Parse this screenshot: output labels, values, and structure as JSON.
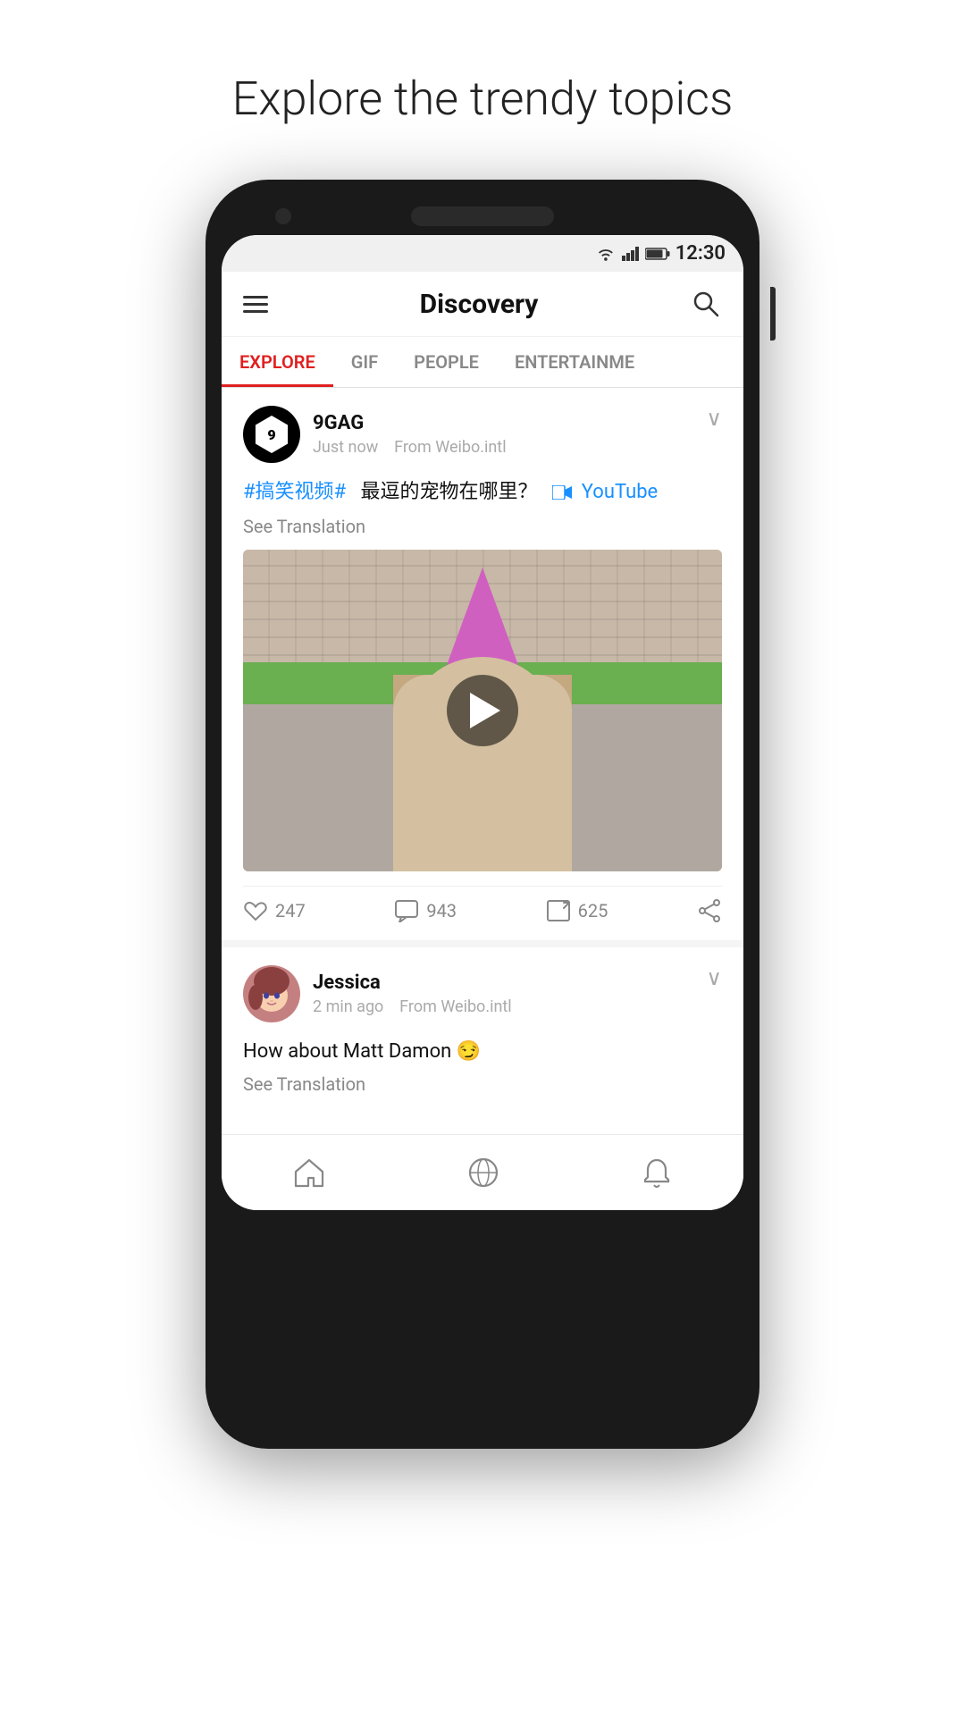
{
  "page": {
    "headline": "Explore the trendy topics"
  },
  "status_bar": {
    "time": "12:30",
    "wifi": "▼",
    "signal": "▲",
    "battery": "🔋"
  },
  "nav": {
    "title": "Discovery",
    "hamburger_label": "Menu",
    "search_label": "Search"
  },
  "tabs": [
    {
      "id": "explore",
      "label": "EXPLORE",
      "active": true
    },
    {
      "id": "gif",
      "label": "GIF",
      "active": false
    },
    {
      "id": "people",
      "label": "PEOPLE",
      "active": false
    },
    {
      "id": "entertainment",
      "label": "ENTERTAINME",
      "active": false
    }
  ],
  "posts": [
    {
      "id": "post1",
      "author": "9GAG",
      "time": "Just now",
      "source": "From Weibo.intl",
      "hashtag": "#搞笑视频#",
      "text_cn": "最逗的宠物在哪里？",
      "yt_label": "YouTube",
      "see_translation": "See Translation",
      "has_video": true,
      "likes": "247",
      "comments": "943",
      "reposts": "625"
    },
    {
      "id": "post2",
      "author": "Jessica",
      "time": "2 min ago",
      "source": "From Weibo.intl",
      "text": "How about Matt Damon 😏",
      "see_translation": "See Translation"
    }
  ],
  "bottom_nav": {
    "home_label": "Home",
    "discover_label": "Discover",
    "notifications_label": "Notifications"
  },
  "icons": {
    "like": "👍",
    "comment": "💬",
    "repost": "↗",
    "share": "⤴"
  }
}
